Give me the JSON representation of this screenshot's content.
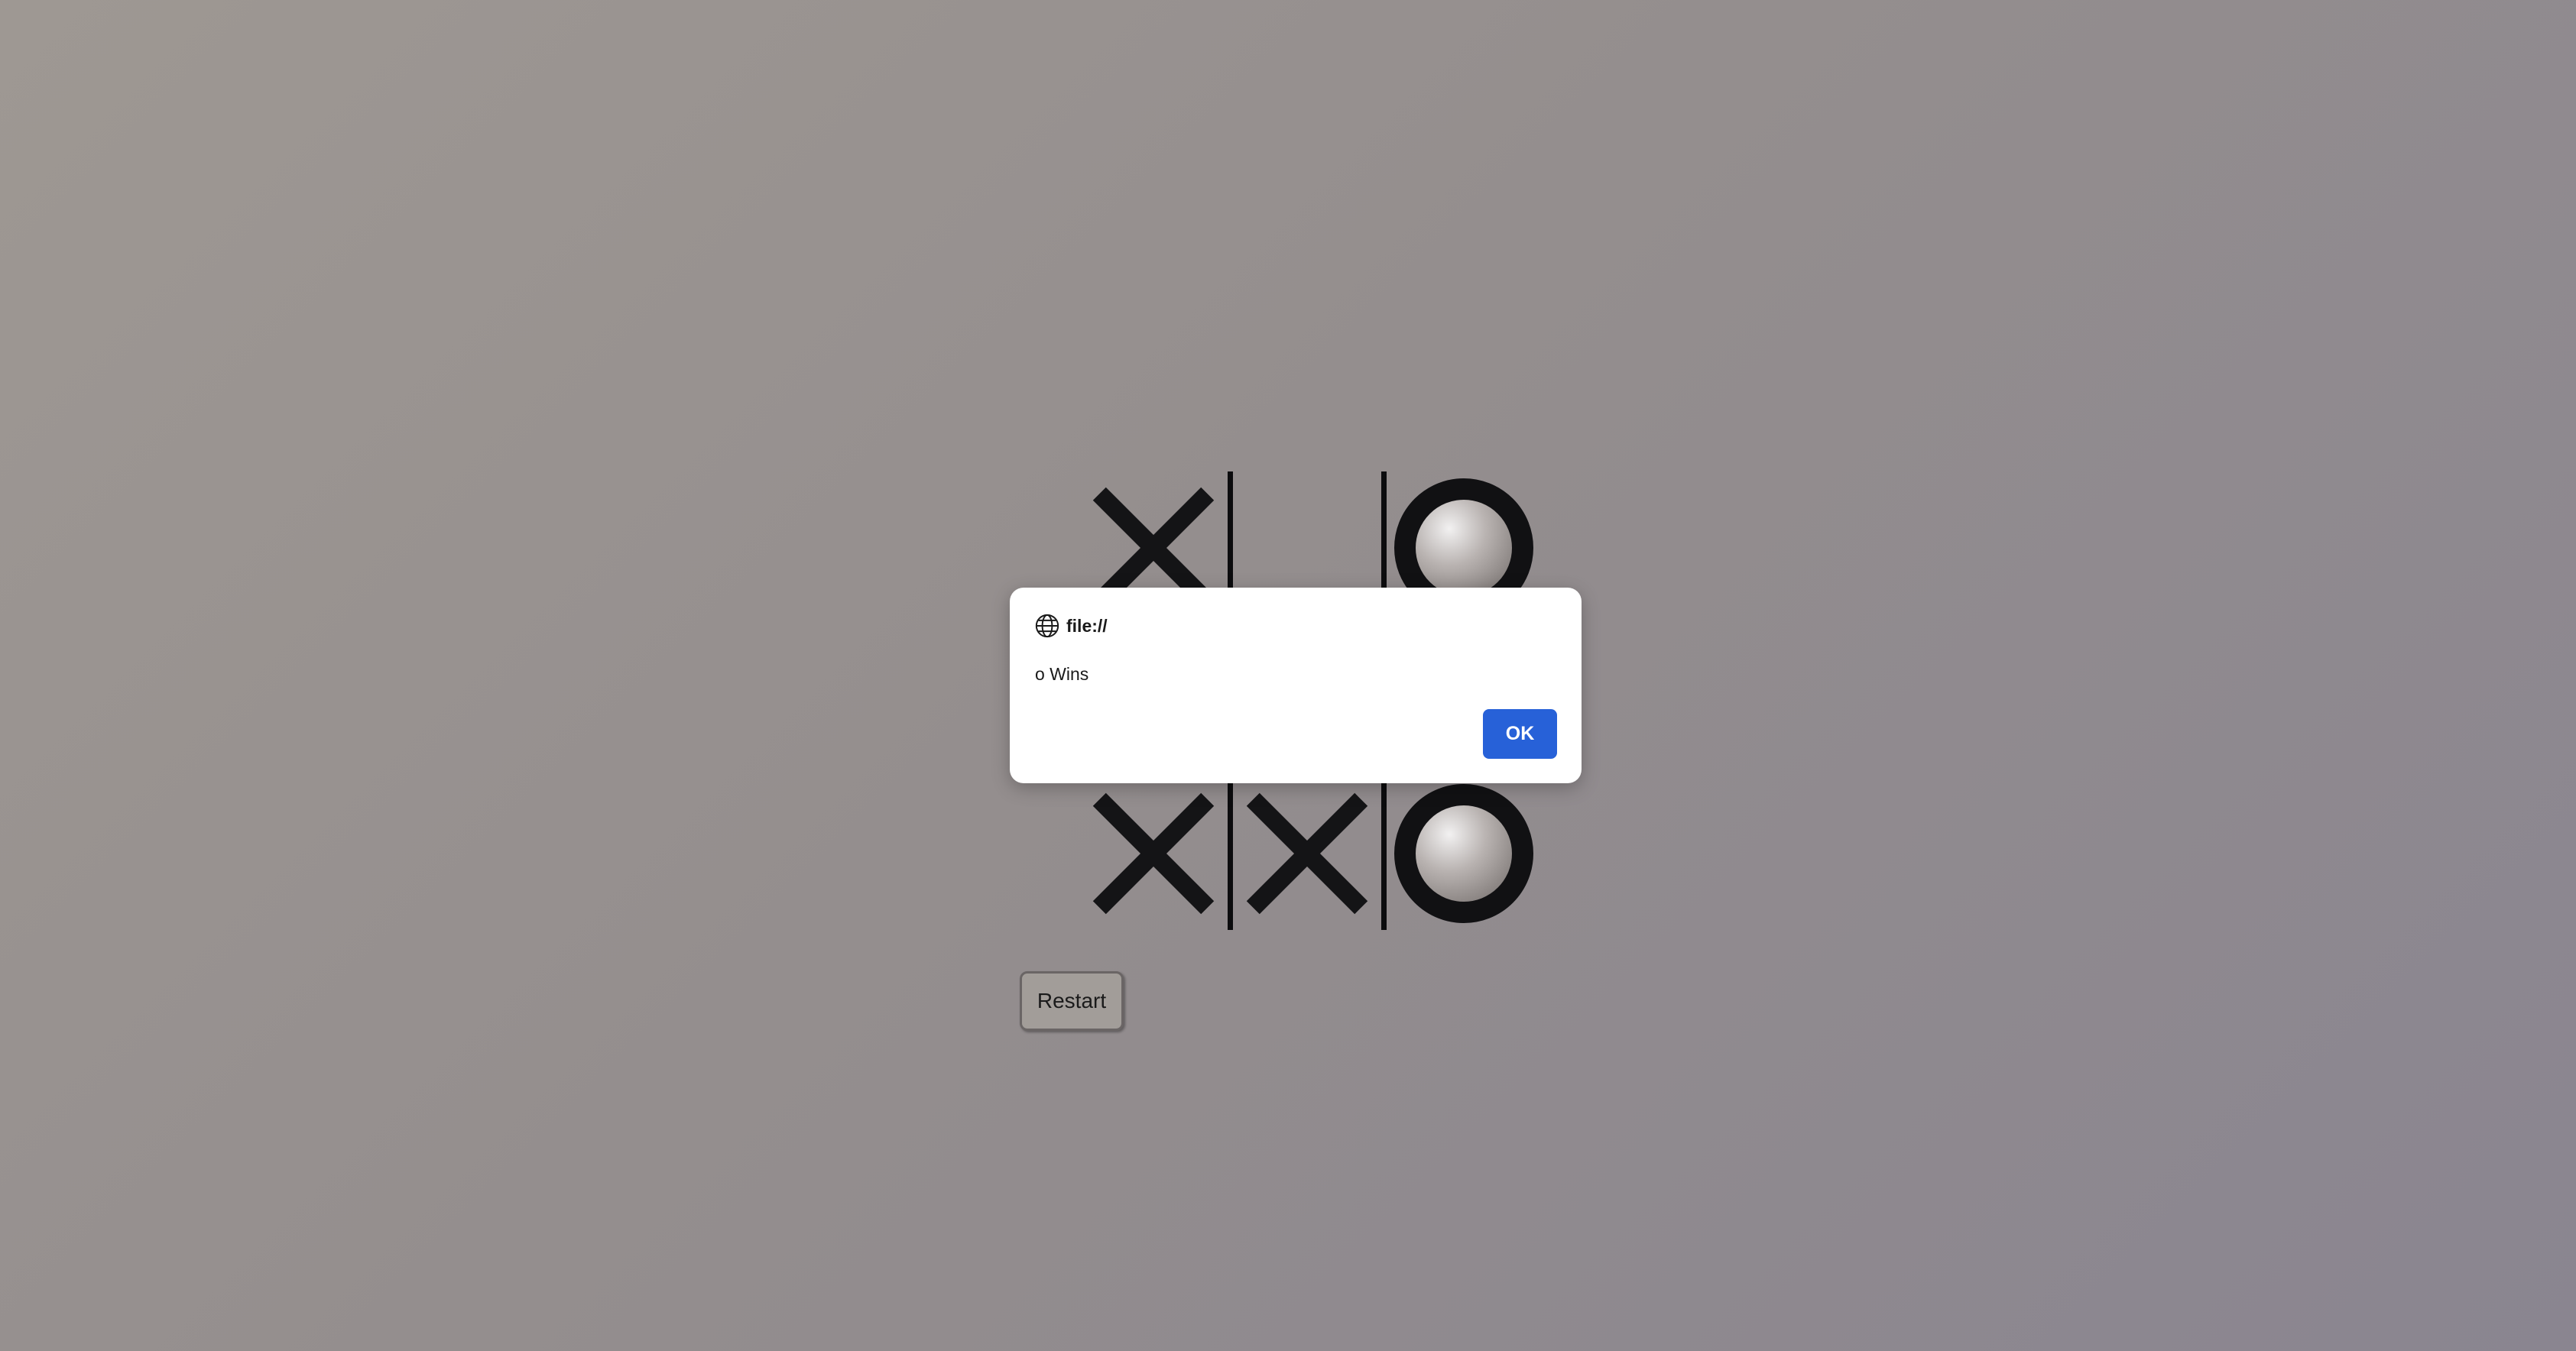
{
  "game": {
    "board": [
      [
        "x",
        "",
        "o"
      ],
      [
        "",
        "",
        ""
      ],
      [
        "x",
        "x",
        "o"
      ]
    ],
    "restart_label": "Restart"
  },
  "dialog": {
    "title": "file://",
    "message": "o Wins",
    "ok_label": "OK",
    "icon": "globe-icon"
  },
  "colors": {
    "ok_button": "#2761d8",
    "mark": "#141416"
  }
}
